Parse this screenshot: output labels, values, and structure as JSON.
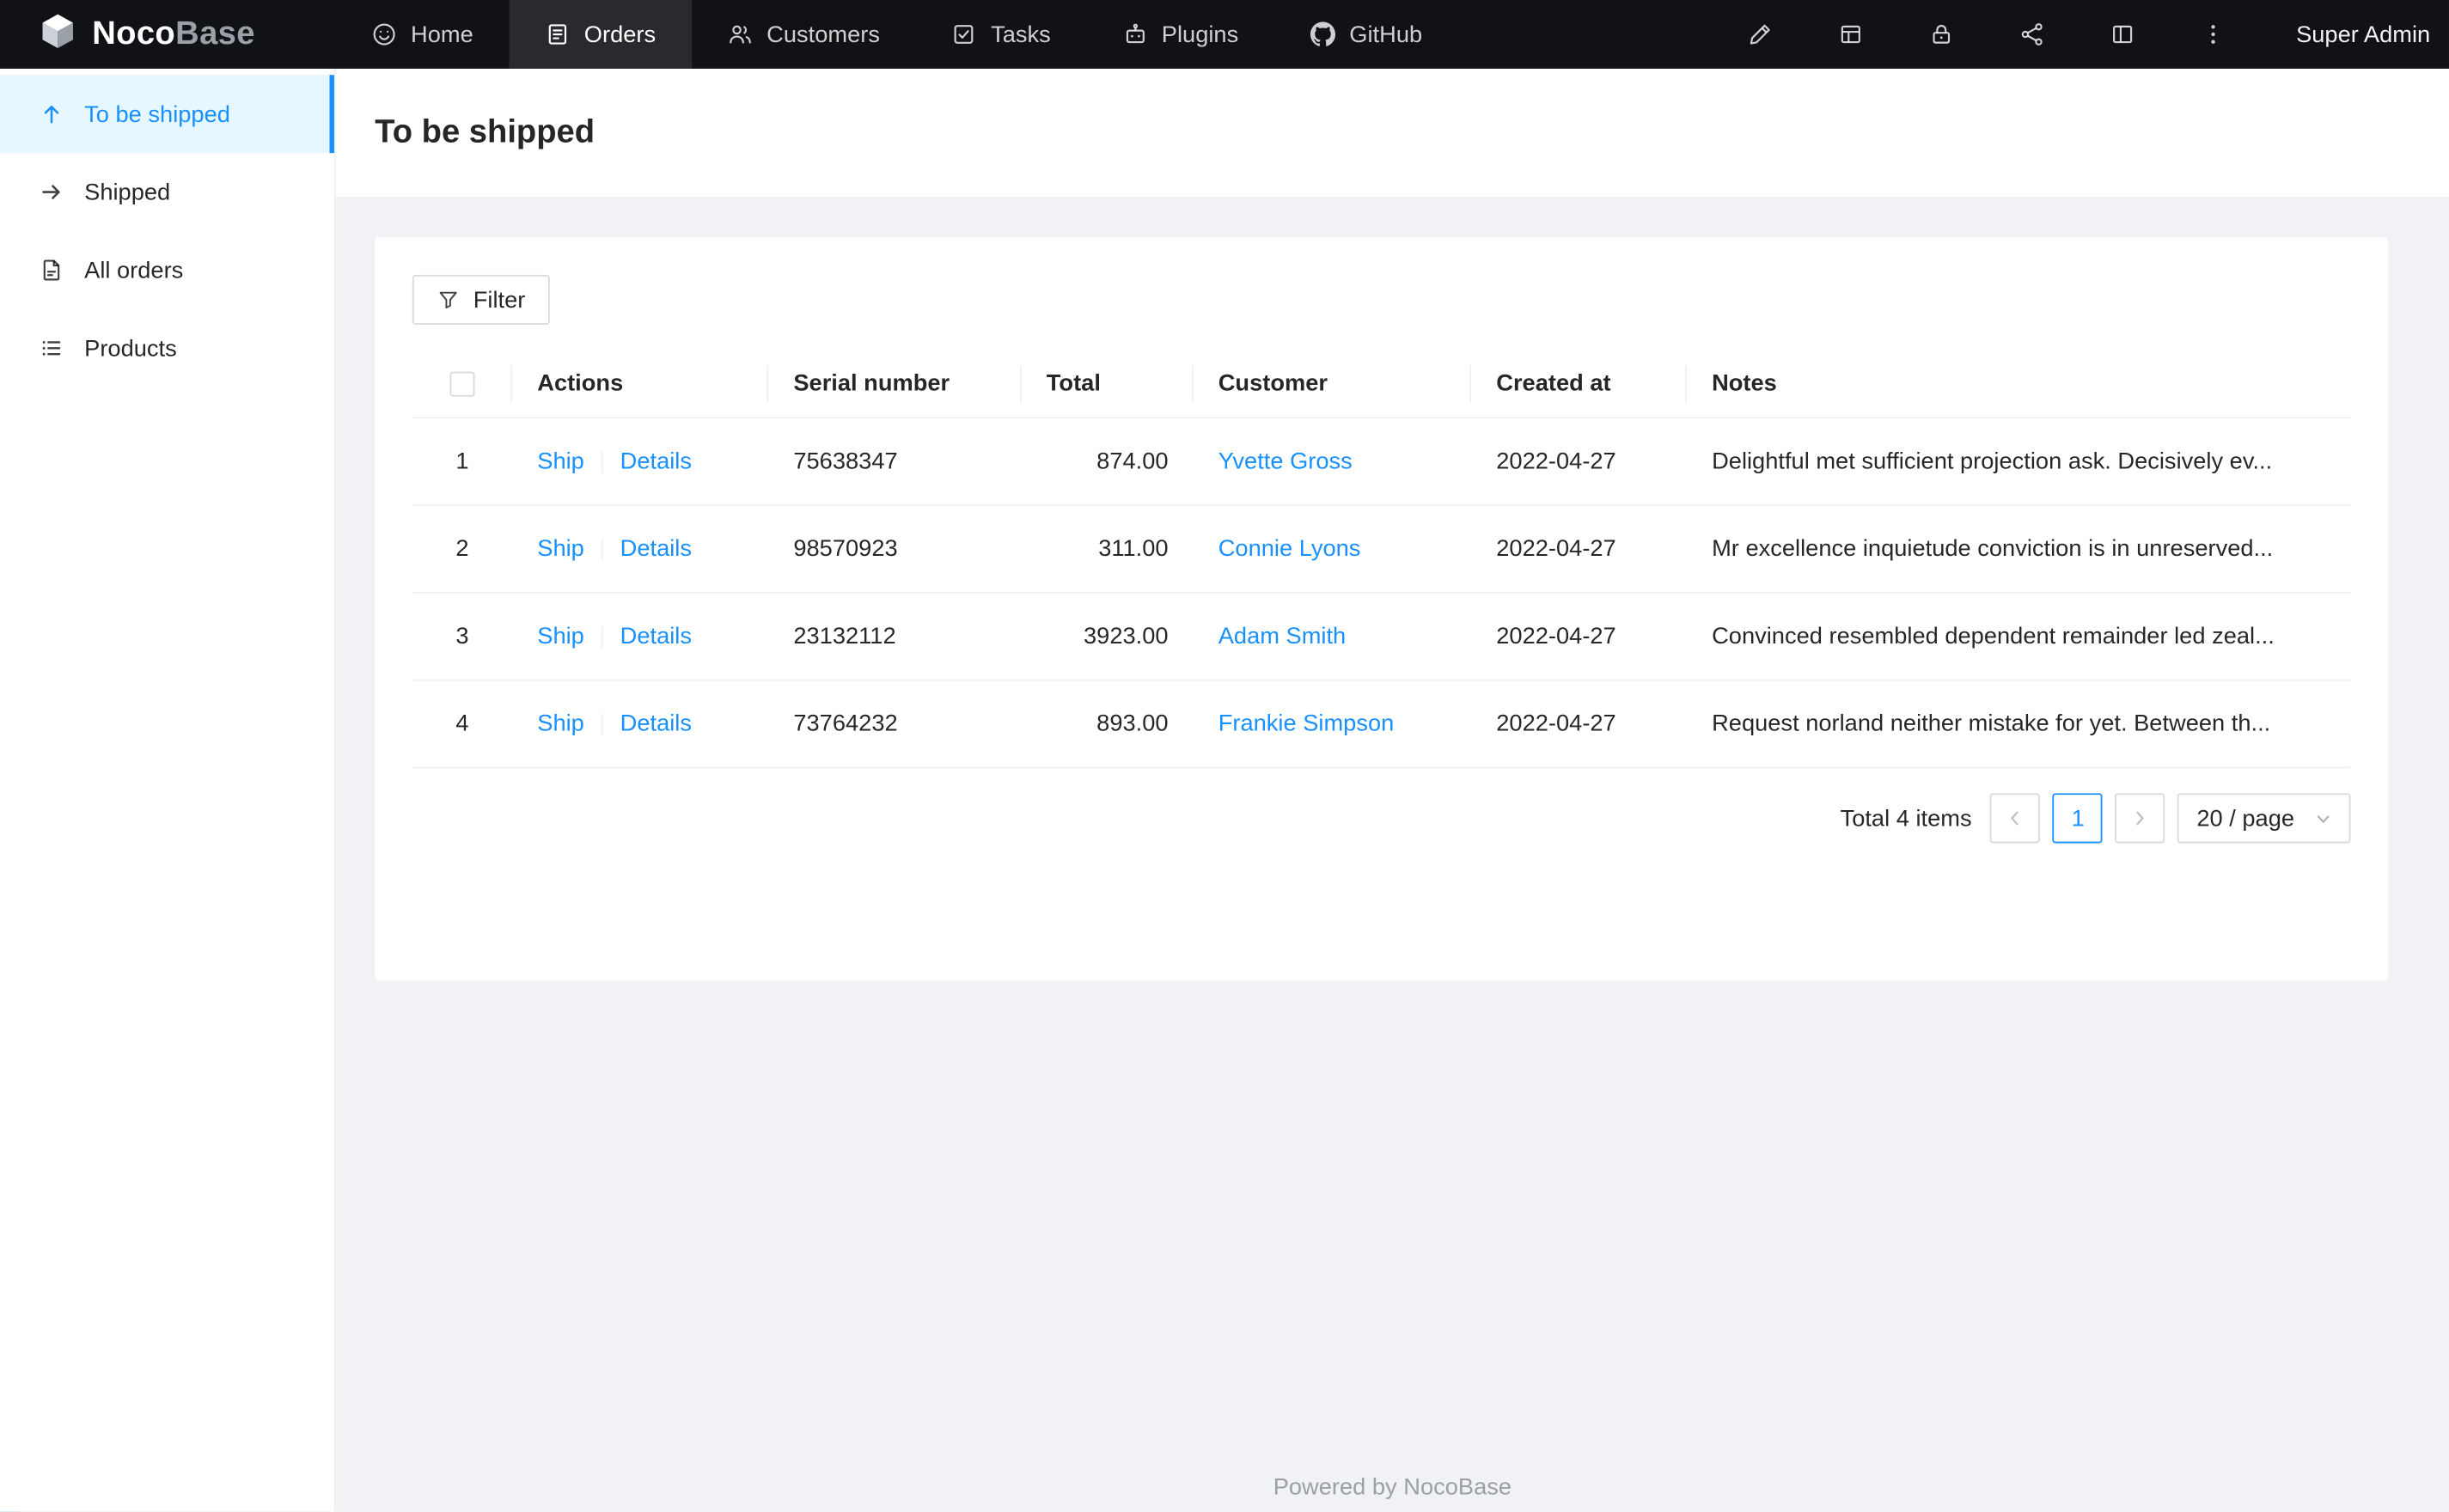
{
  "navbar": {
    "logo_noco": "Noco",
    "logo_base": "Base",
    "items": [
      {
        "label": "Home"
      },
      {
        "label": "Orders"
      },
      {
        "label": "Customers"
      },
      {
        "label": "Tasks"
      },
      {
        "label": "Plugins"
      },
      {
        "label": "GitHub"
      }
    ],
    "right_icons": [
      "ui-editor-icon",
      "collections-icon",
      "lock-icon",
      "api-nodes-icon",
      "layout-icon",
      "more-icon"
    ],
    "user": "Super Admin"
  },
  "sidebar": {
    "items": [
      {
        "label": "To be shipped"
      },
      {
        "label": "Shipped"
      },
      {
        "label": "All orders"
      },
      {
        "label": "Products"
      }
    ]
  },
  "page": {
    "title": "To be shipped"
  },
  "toolbar": {
    "filter_label": "Filter"
  },
  "table": {
    "columns": [
      "Actions",
      "Serial number",
      "Total",
      "Customer",
      "Created at",
      "Notes"
    ],
    "actions": [
      "Ship",
      "Details"
    ],
    "rows": [
      {
        "index": "1",
        "serial": "75638347",
        "total": "874.00",
        "customer": "Yvette Gross",
        "created_at": "2022-04-27",
        "notes": "Delightful met sufficient projection ask. Decisively ev..."
      },
      {
        "index": "2",
        "serial": "98570923",
        "total": "311.00",
        "customer": "Connie Lyons",
        "created_at": "2022-04-27",
        "notes": "Mr excellence inquietude conviction is in unreserved..."
      },
      {
        "index": "3",
        "serial": "23132112",
        "total": "3923.00",
        "customer": "Adam Smith",
        "created_at": "2022-04-27",
        "notes": "Convinced resembled dependent remainder led zeal..."
      },
      {
        "index": "4",
        "serial": "73764232",
        "total": "893.00",
        "customer": "Frankie Simpson",
        "created_at": "2022-04-27",
        "notes": "Request norland neither mistake for yet. Between th..."
      }
    ]
  },
  "pagination": {
    "total_text": "Total 4 items",
    "current_page": "1",
    "page_size": "20 / page"
  },
  "footer": {
    "text": "Powered by NocoBase"
  },
  "colors": {
    "accent": "#1890ff",
    "navbar_bg": "#101216",
    "active_item_bg": "#e6f7ff",
    "content_bg": "#f0f2f5"
  }
}
